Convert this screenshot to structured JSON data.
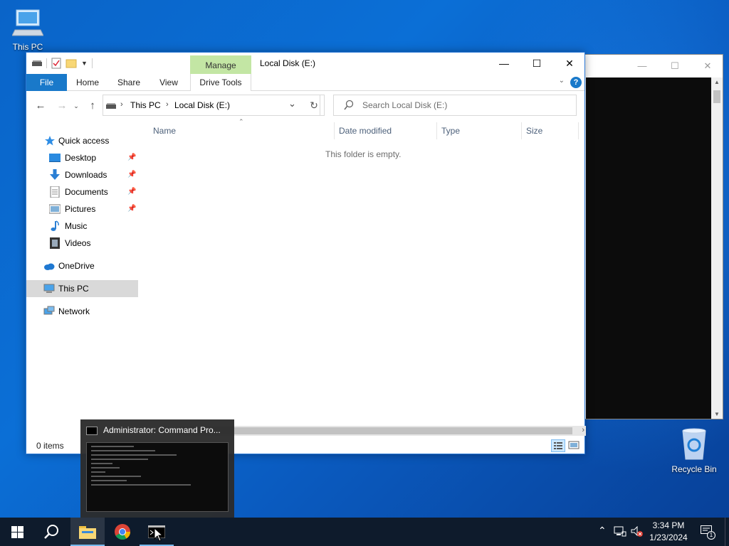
{
  "desktop": {
    "icons": [
      {
        "label": "This PC"
      },
      {
        "label": "Recycle Bin"
      }
    ]
  },
  "explorer": {
    "title": "Local Disk (E:)",
    "context_tab": "Manage",
    "tabs": [
      "File",
      "Home",
      "Share",
      "View",
      "Drive Tools"
    ],
    "address": {
      "root": "This PC",
      "current": "Local Disk (E:)"
    },
    "search_placeholder": "Search Local Disk (E:)",
    "nav": {
      "quick_access": "Quick access",
      "items": [
        "Desktop",
        "Downloads",
        "Documents",
        "Pictures",
        "Music",
        "Videos"
      ],
      "onedrive": "OneDrive",
      "this_pc": "This PC",
      "network": "Network"
    },
    "columns": [
      "Name",
      "Date modified",
      "Type",
      "Size"
    ],
    "empty_message": "This folder is empty.",
    "status": "0 items"
  },
  "taskbar_preview": {
    "title": "Administrator: Command Pro..."
  },
  "clock": {
    "time": "3:34 PM",
    "date": "1/23/2024"
  },
  "notifications_count": "1",
  "colors": {
    "accent": "#1979ca",
    "manage_tab": "#c3e6a4",
    "taskbar": "#0e1b2c"
  }
}
